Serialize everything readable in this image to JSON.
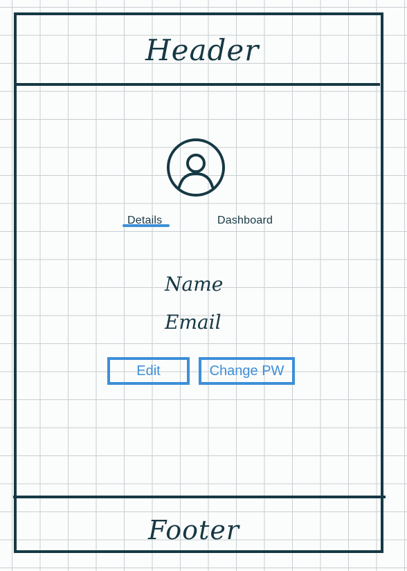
{
  "header": {
    "label": "Header"
  },
  "profile": {
    "avatar_icon": "user-avatar-icon"
  },
  "tabs": [
    {
      "label": "Details",
      "active": true
    },
    {
      "label": "Dashboard",
      "active": false
    }
  ],
  "fields": {
    "name_label": "Name",
    "email_label": "Email"
  },
  "actions": {
    "edit_label": "Edit",
    "change_pw_label": "Change PW"
  },
  "footer": {
    "label": "Footer"
  },
  "colors": {
    "ink": "#163844",
    "accent": "#3d8fd8",
    "grid": "#c9ced1",
    "paper": "#fbfcfc"
  }
}
